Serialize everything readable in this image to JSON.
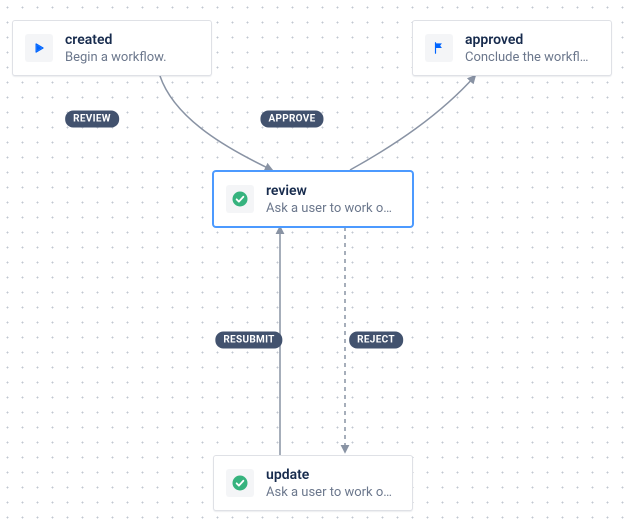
{
  "nodes": {
    "created": {
      "title": "created",
      "desc": "Begin a workflow."
    },
    "approved": {
      "title": "approved",
      "desc": "Conclude the workfl…"
    },
    "review": {
      "title": "review",
      "desc": "Ask a user to work o…"
    },
    "update": {
      "title": "update",
      "desc": "Ask a user to work o…"
    }
  },
  "edges": {
    "review": {
      "label": "REVIEW"
    },
    "approve": {
      "label": "APPROVE"
    },
    "resubmit": {
      "label": "RESUBMIT"
    },
    "reject": {
      "label": "REJECT"
    }
  }
}
